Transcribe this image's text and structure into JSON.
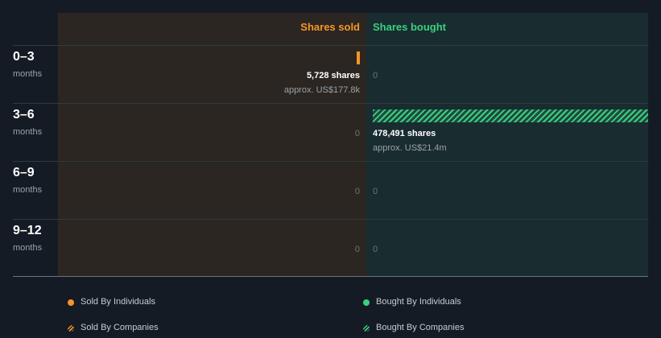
{
  "chart_data": {
    "type": "bar",
    "columns": {
      "sold_label": "Shares sold",
      "bought_label": "Shares bought"
    },
    "rows": [
      {
        "period": "0–3",
        "unit": "months",
        "sold": {
          "shares": 5728,
          "shares_text": "5,728 shares",
          "approx_text": "approx. US$177.8k"
        },
        "bought": {
          "shares": 0,
          "zero_text": "0"
        }
      },
      {
        "period": "3–6",
        "unit": "months",
        "sold": {
          "shares": 0,
          "zero_text": "0"
        },
        "bought": {
          "shares": 478491,
          "shares_text": "478,491 shares",
          "approx_text": "approx. US$21.4m",
          "type": "companies"
        }
      },
      {
        "period": "6–9",
        "unit": "months",
        "sold": {
          "shares": 0,
          "zero_text": "0"
        },
        "bought": {
          "shares": 0,
          "zero_text": "0"
        }
      },
      {
        "period": "9–12",
        "unit": "months",
        "sold": {
          "shares": 0,
          "zero_text": "0"
        },
        "bought": {
          "shares": 0,
          "zero_text": "0"
        }
      }
    ],
    "legend": [
      {
        "label": "Sold By Individuals",
        "color": "#f59527",
        "style": "solid"
      },
      {
        "label": "Bought By Individuals",
        "color": "#3ad080",
        "style": "solid"
      },
      {
        "label": "Sold By Companies",
        "color": "#f59527",
        "style": "hatched"
      },
      {
        "label": "Bought By Companies",
        "color": "#3ad080",
        "style": "hatched"
      }
    ],
    "colors": {
      "sold": "#f59527",
      "bought": "#3ad080",
      "sold_panel": "#2b2621",
      "bought_panel": "#192c2f",
      "background": "#151b24"
    }
  }
}
